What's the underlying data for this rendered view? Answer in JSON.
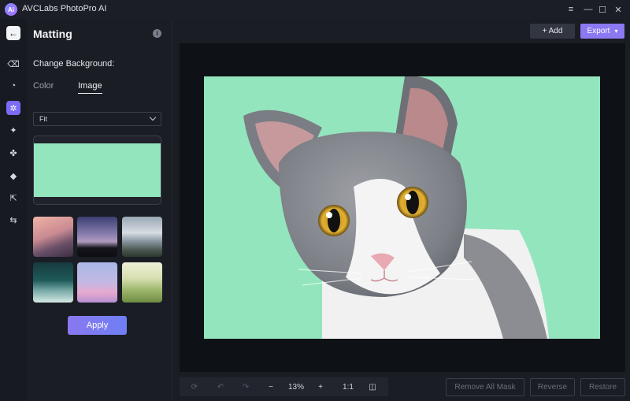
{
  "app": {
    "title": "AVCLabs PhotoPro AI",
    "logo": "Ai"
  },
  "window_controls": [
    "≡",
    "—",
    "☐",
    "✕"
  ],
  "rail": {
    "back_icon": "←",
    "items": [
      {
        "name": "eraser-icon",
        "glyph": "⌫"
      },
      {
        "name": "shapes-icon",
        "glyph": "◔"
      },
      {
        "name": "matting-icon",
        "glyph": "✲"
      },
      {
        "name": "sparkle-icon",
        "glyph": "✦"
      },
      {
        "name": "flower-icon",
        "glyph": "✤"
      },
      {
        "name": "paint-bucket-icon",
        "glyph": "◆"
      },
      {
        "name": "resize-icon",
        "glyph": "⇱"
      },
      {
        "name": "adjust-icon",
        "glyph": "⇆"
      }
    ]
  },
  "panel": {
    "title": "Matting",
    "info_icon": "i",
    "section_label": "Change Background:",
    "tabs": [
      {
        "label": "Color"
      },
      {
        "label": "Image"
      }
    ],
    "fit_select": {
      "value": "Fit"
    },
    "preview_color": "#93e5bd",
    "thumbnails": [
      {
        "name": "mountain-sunset",
        "bg": "linear-gradient(160deg,#f0b2a6 0%,#c98a92 45%,#6a5068 70%,#3c2e44 100%)"
      },
      {
        "name": "dusk-trees",
        "bg": "linear-gradient(180deg,#3b3f73 0%,#8a80b0 45%,#b29bbd 62%,#15141c 78%,#0d0d12 100%)"
      },
      {
        "name": "snowy-mountain",
        "bg": "linear-gradient(180deg,#9aa7b3 0%,#d7dde3 40%,#8d9aa4 60%,#46524a 85%,#2e3a30 100%)"
      },
      {
        "name": "ocean-wave",
        "bg": "linear-gradient(180deg,#163a3e 0%,#1f5a5a 45%,#76a9a6 70%,#d6e8e6 100%)"
      },
      {
        "name": "pink-clouds",
        "bg": "linear-gradient(180deg,#a9b8e6 0%,#c3b9e4 50%,#e6a9cf 75%,#b690d2 100%)"
      },
      {
        "name": "meadow-bokeh",
        "bg": "linear-gradient(180deg,#eef0d8 0%,#d6dfb0 40%,#9cb56a 70%,#6e8c44 100%)"
      }
    ],
    "apply_label": "Apply"
  },
  "toolbar": {
    "add_label": "+ Add",
    "export_label": "Export"
  },
  "canvas": {
    "bg_color": "#93e5bd"
  },
  "zoom": {
    "level": "13%",
    "minus": "−",
    "plus": "+",
    "one_to_one": "1:1"
  },
  "actions": {
    "remove_all_mask": "Remove All Mask",
    "reverse": "Reverse",
    "restore": "Restore"
  }
}
